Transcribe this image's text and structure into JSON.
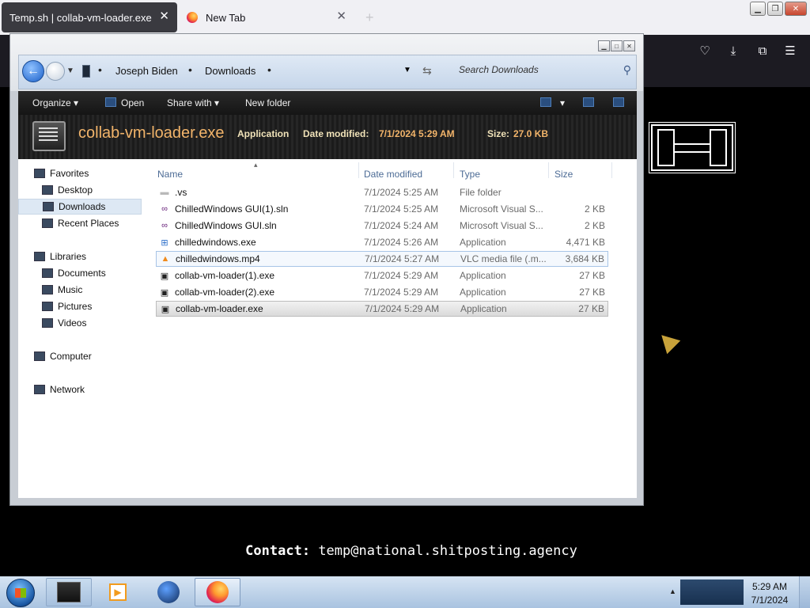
{
  "browser": {
    "tabs": [
      {
        "label": "Temp.sh | collab-vm-loader.exe",
        "active": true
      },
      {
        "label": "New Tab",
        "active": false
      }
    ],
    "close_glyph": "✕",
    "new_tab_glyph": "+"
  },
  "explorer": {
    "breadcrumb": [
      "Joseph Biden",
      "Downloads"
    ],
    "search_placeholder": "Search Downloads",
    "commands": {
      "organize": "Organize",
      "open": "Open",
      "share_with": "Share with",
      "new_folder": "New folder"
    },
    "details": {
      "filename": "collab-vm-loader.exe",
      "type": "Application",
      "date_label": "Date modified:",
      "date_value": "7/1/2024 5:29 AM",
      "size_label": "Size:",
      "size_value": "27.0 KB"
    },
    "nav": [
      {
        "label": "Favorites",
        "icon": "star-icon",
        "indent": 0
      },
      {
        "label": "Desktop",
        "icon": "desktop-icon",
        "indent": 1
      },
      {
        "label": "Downloads",
        "icon": "downloads-folder-icon",
        "indent": 1,
        "selected": true
      },
      {
        "label": "Recent Places",
        "icon": "recent-places-icon",
        "indent": 1
      },
      {
        "label": "Libraries",
        "icon": "libraries-icon",
        "indent": 0
      },
      {
        "label": "Documents",
        "icon": "documents-icon",
        "indent": 1
      },
      {
        "label": "Music",
        "icon": "music-icon",
        "indent": 1
      },
      {
        "label": "Pictures",
        "icon": "pictures-icon",
        "indent": 1
      },
      {
        "label": "Videos",
        "icon": "videos-icon",
        "indent": 1
      },
      {
        "label": "Computer",
        "icon": "computer-icon",
        "indent": 0
      },
      {
        "label": "Network",
        "icon": "network-icon",
        "indent": 0
      }
    ],
    "columns": {
      "name": "Name",
      "date": "Date modified",
      "type": "Type",
      "size": "Size"
    },
    "files": [
      {
        "name": ".vs",
        "date": "7/1/2024 5:25 AM",
        "type": "File folder",
        "size": "",
        "icon": "folder-icon"
      },
      {
        "name": "ChilledWindows GUI(1).sln",
        "date": "7/1/2024 5:25 AM",
        "type": "Microsoft Visual S...",
        "size": "2 KB",
        "icon": "visual-studio-icon"
      },
      {
        "name": "ChilledWindows GUI.sln",
        "date": "7/1/2024 5:24 AM",
        "type": "Microsoft Visual S...",
        "size": "2 KB",
        "icon": "visual-studio-icon"
      },
      {
        "name": "chilledwindows.exe",
        "date": "7/1/2024 5:26 AM",
        "type": "Application",
        "size": "4,471 KB",
        "icon": "windows-app-icon"
      },
      {
        "name": "chilledwindows.mp4",
        "date": "7/1/2024 5:27 AM",
        "type": "VLC media file (.m...",
        "size": "3,684 KB",
        "icon": "vlc-icon",
        "hover": true
      },
      {
        "name": "collab-vm-loader(1).exe",
        "date": "7/1/2024 5:29 AM",
        "type": "Application",
        "size": "27 KB",
        "icon": "exe-icon"
      },
      {
        "name": "collab-vm-loader(2).exe",
        "date": "7/1/2024 5:29 AM",
        "type": "Application",
        "size": "27 KB",
        "icon": "exe-icon"
      },
      {
        "name": "collab-vm-loader.exe",
        "date": "7/1/2024 5:29 AM",
        "type": "Application",
        "size": "27 KB",
        "icon": "exe-icon",
        "selected": true
      }
    ]
  },
  "page": {
    "contact_label": "Contact:",
    "contact_email": "temp@national.shitposting.agency"
  },
  "taskbar": {
    "time": "5:29 AM",
    "date": "7/1/2024"
  }
}
